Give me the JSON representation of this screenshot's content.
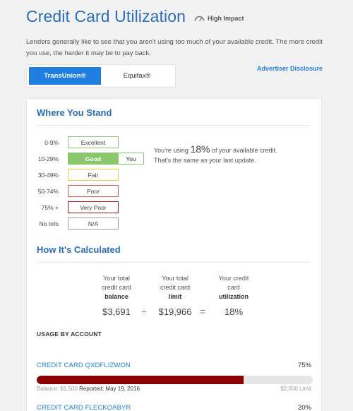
{
  "header": {
    "title": "Credit Card Utilization",
    "impact_label": "High Impact"
  },
  "intro": "Lenders generally like to see that you aren't using too much of your available credit. The more credit you use, the harder it may be to pay back.",
  "tabs": [
    {
      "label": "TransUnion®",
      "active": true
    },
    {
      "label": "Equifax®",
      "active": false
    }
  ],
  "disclosure": "Advertiser Disclosure",
  "where": {
    "title": "Where You Stand",
    "scale": [
      {
        "range": "0-9%",
        "label": "Excellent",
        "color": "#8bc76c"
      },
      {
        "range": "10-29%",
        "label": "Good",
        "color": "#8bc76c",
        "you": "You"
      },
      {
        "range": "30-49%",
        "label": "Fair",
        "color": "#f2c94c"
      },
      {
        "range": "50-74%",
        "label": "Poor",
        "color": "#d9534f"
      },
      {
        "range": "75% +",
        "label": "Very Poor",
        "color": "#a31a1a"
      },
      {
        "range": "No Info",
        "label": "N/A",
        "color": "#999999"
      }
    ],
    "using_prefix": "You're using",
    "using_pct": "18%",
    "using_suffix": "of your available credit.",
    "using_line2": "That's the same as your last update."
  },
  "calc": {
    "title": "How It's Calculated",
    "balance": {
      "l1": "Your total",
      "l2": "credit card",
      "bold": "balance",
      "value": "$3,691"
    },
    "limit": {
      "l1": "Your total",
      "l2": "credit card",
      "bold": "limit",
      "value": "$19,966"
    },
    "util": {
      "l1": "Your credit",
      "l2": "card",
      "bold": "utilization",
      "value": "18%"
    },
    "divide": "÷",
    "equals": "="
  },
  "usage": {
    "label": "USAGE BY ACCOUNT",
    "accounts": [
      {
        "name": "CREDIT CARD QXDFLIZWON",
        "pct": "75%",
        "fill": 0.75,
        "balance": "Balance: $1,500",
        "reported": "Reported: May 19, 2016",
        "limit": "$2,000 Limit",
        "color": "#8b0000"
      },
      {
        "name": "CREDIT CARD FLECKOABYR",
        "pct": "20%"
      }
    ]
  }
}
